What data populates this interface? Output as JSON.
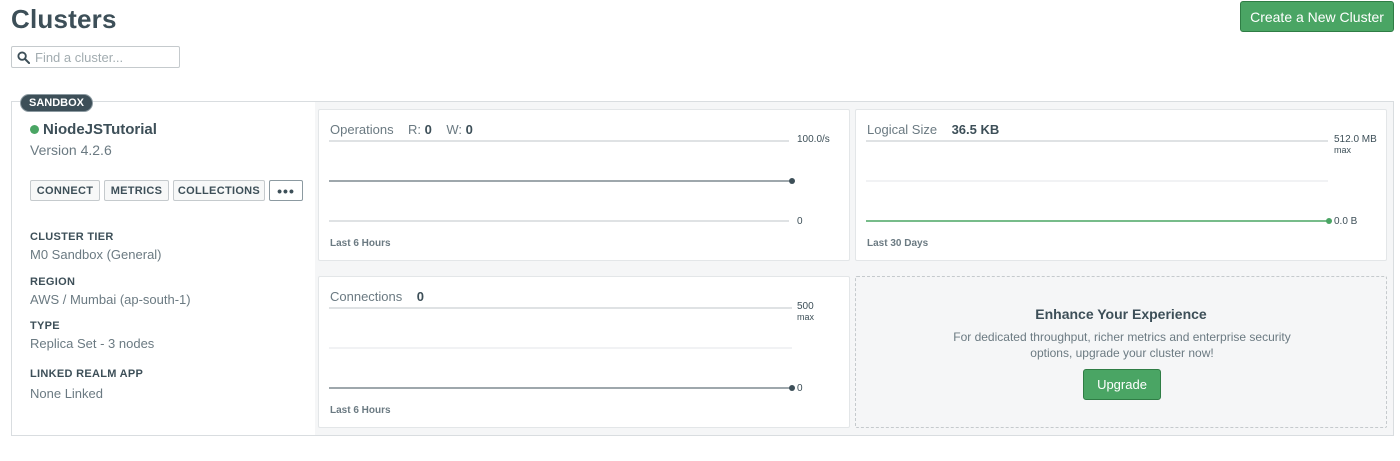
{
  "page": {
    "title": "Clusters"
  },
  "header": {
    "create_button_label": "Create a New Cluster"
  },
  "search": {
    "placeholder": "Find a cluster...",
    "value": ""
  },
  "cluster": {
    "badge": "SANDBOX",
    "name": "NiodeJSTutorial",
    "status_color": "#4aa564",
    "version": "Version 4.2.6",
    "actions": {
      "connect": "CONNECT",
      "metrics": "METRICS",
      "collections": "COLLECTIONS",
      "more": "•••"
    },
    "info": [
      {
        "label": "CLUSTER TIER",
        "value": "M0 Sandbox (General)"
      },
      {
        "label": "REGION",
        "value": "AWS / Mumbai (ap-south-1)"
      },
      {
        "label": "TYPE",
        "value": "Replica Set - 3 nodes"
      },
      {
        "label": "LINKED REALM APP",
        "value": "None Linked"
      }
    ]
  },
  "metrics": {
    "operations": {
      "title": "Operations",
      "r_label": "R:",
      "r_value": "0",
      "w_label": "W:",
      "w_value": "0",
      "axis_max": "100.0/s",
      "axis_min": "0",
      "range": "Last 6 Hours"
    },
    "logical_size": {
      "title": "Logical Size",
      "value": "36.5 KB",
      "axis_max": "512.0 MB",
      "axis_max_sub": "max",
      "axis_min": "0.0 B",
      "range": "Last 30 Days"
    },
    "connections": {
      "title": "Connections",
      "value": "0",
      "axis_max": "500",
      "axis_max_sub": "max",
      "axis_min": "0",
      "range": "Last 6 Hours"
    }
  },
  "upgrade": {
    "title": "Enhance Your Experience",
    "text": "For dedicated throughput, richer metrics and enterprise security options, upgrade your cluster now!",
    "button_label": "Upgrade"
  },
  "colors": {
    "accent": "#4aa564",
    "text": "#3d4f58",
    "muted": "#6b7a82"
  }
}
